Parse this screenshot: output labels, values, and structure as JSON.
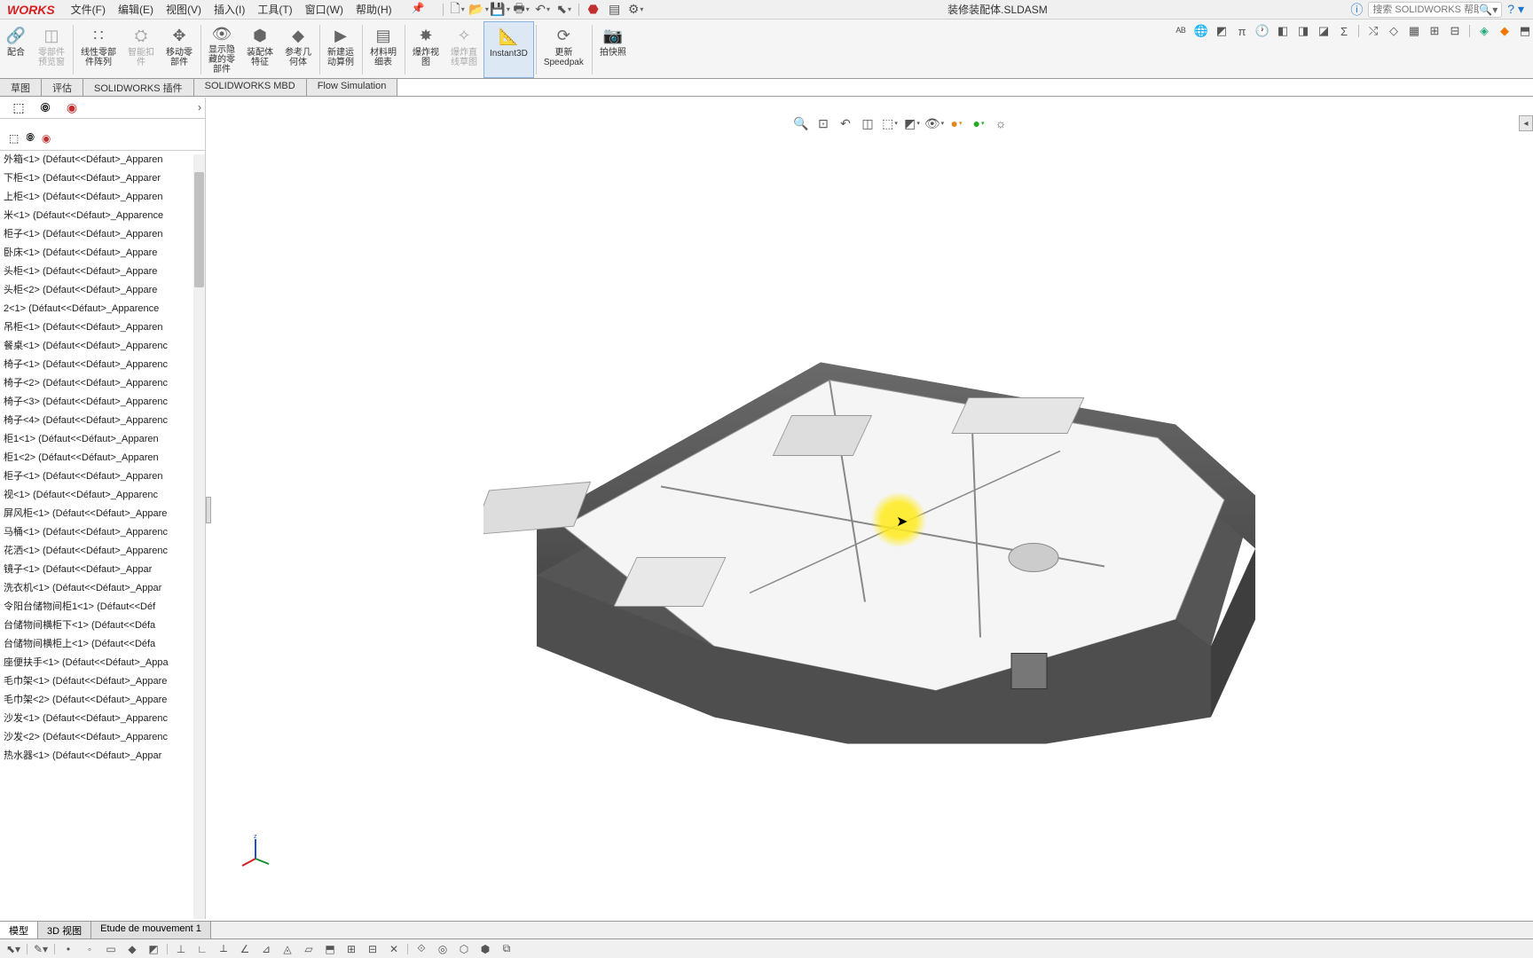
{
  "app": {
    "logo": "WORKS"
  },
  "menu": {
    "file": "文件(F)",
    "edit": "编辑(E)",
    "view": "视图(V)",
    "insert": "插入(I)",
    "tools": "工具(T)",
    "window": "窗口(W)",
    "help": "帮助(H)"
  },
  "document_title": "装修装配体.SLDASM",
  "search": {
    "placeholder": "搜索 SOLIDWORKS 帮助"
  },
  "ribbon": {
    "mate": "配合",
    "preview": "零部件\n预览窗",
    "linear_pattern": "线性零部\n件阵列",
    "smart_fastener": "智能扣\n件",
    "move_component": "移动零\n部件",
    "show_hidden": "显示隐\n藏的零\n部件",
    "assembly_feature": "装配体\n特征",
    "ref_geom": "参考几\n何体",
    "new_motion": "新建运\n动算例",
    "bom": "材料明\n细表",
    "exploded_view": "爆炸视\n图",
    "exploded_sketch": "爆炸直\n线草图",
    "instant3d": "Instant3D",
    "speedpak": "更新\nSpeedpak",
    "snapshot": "拍快照"
  },
  "tabs": {
    "sketch": "草图",
    "evaluate": "评估",
    "addins": "SOLIDWORKS 插件",
    "mbd": "SOLIDWORKS MBD",
    "flow": "Flow Simulation"
  },
  "tree": [
    "外箱<1> (Défaut<<Défaut>_Apparen",
    "下柜<1> (Défaut<<Défaut>_Apparer",
    "上柜<1> (Défaut<<Défaut>_Apparen",
    "米<1> (Défaut<<Défaut>_Apparence",
    "柜子<1> (Défaut<<Défaut>_Apparen",
    "卧床<1> (Défaut<<Défaut>_Appare",
    "头柜<1> (Défaut<<Défaut>_Appare",
    "头柜<2> (Défaut<<Défaut>_Appare",
    "2<1> (Défaut<<Défaut>_Apparence",
    "吊柜<1> (Défaut<<Défaut>_Apparen",
    "餐桌<1> (Défaut<<Défaut>_Apparenc",
    "椅子<1> (Défaut<<Défaut>_Apparenc",
    "椅子<2> (Défaut<<Défaut>_Apparenc",
    "椅子<3> (Défaut<<Défaut>_Apparenc",
    "椅子<4> (Défaut<<Défaut>_Apparenc",
    "柜1<1> (Défaut<<Défaut>_Apparen",
    "柜1<2> (Défaut<<Défaut>_Apparen",
    "柜子<1> (Défaut<<Défaut>_Apparen",
    "视<1> (Défaut<<Défaut>_Apparenc",
    "屏风柜<1> (Défaut<<Défaut>_Appare",
    "马桶<1> (Défaut<<Défaut>_Apparenc",
    "花洒<1> (Défaut<<Défaut>_Apparenc",
    "镜子<1> (Défaut<<Défaut>_Appar",
    "洗衣机<1> (Défaut<<Défaut>_Appar",
    "令阳台储物间柜1<1> (Défaut<<Déf",
    "台储物间横柜下<1> (Défaut<<Défa",
    "台储物间横柜上<1> (Défaut<<Défa",
    "座便扶手<1> (Défaut<<Défaut>_Appa",
    "毛巾架<1> (Défaut<<Défaut>_Appare",
    "毛巾架<2> (Défaut<<Défaut>_Appare",
    "沙发<1> (Défaut<<Défaut>_Apparenc",
    "沙发<2> (Défaut<<Défaut>_Apparenc",
    "热水器<1> (Défaut<<Défaut>_Appar"
  ],
  "bottom_tabs": {
    "model": "模型",
    "view3d": "3D 视图",
    "motion": "Etude de mouvement 1"
  }
}
